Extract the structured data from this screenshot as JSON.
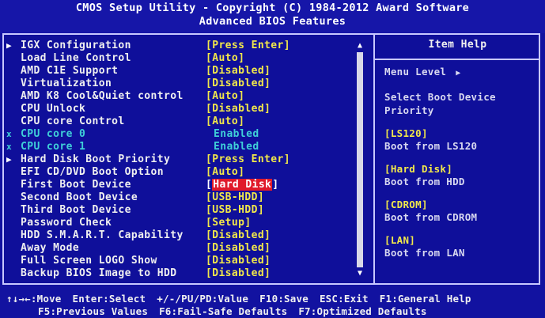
{
  "header": {
    "line1": "CMOS Setup Utility - Copyright (C) 1984-2012 Award Software",
    "line2": "Advanced BIOS Features"
  },
  "settings": [
    {
      "label": "IGX Configuration",
      "value": "[Press Enter]",
      "submenu": true,
      "arrow": "▶"
    },
    {
      "label": "Load Line Control",
      "value": "[Auto]"
    },
    {
      "label": "AMD C1E Support",
      "value": "[Disabled]"
    },
    {
      "label": "Virtualization",
      "value": "[Disabled]"
    },
    {
      "label": "AMD K8 Cool&Quiet control",
      "value": "[Auto]"
    },
    {
      "label": "CPU Unlock",
      "value": "[Disabled]"
    },
    {
      "label": "CPU core Control",
      "value": "[Auto]"
    },
    {
      "label": "CPU core 0",
      "value": "Enabled",
      "disabled": true,
      "arrow": "x"
    },
    {
      "label": "CPU core 1",
      "value": "Enabled",
      "disabled": true,
      "arrow": "x"
    },
    {
      "label": "Hard Disk Boot Priority",
      "value": "[Press Enter]",
      "submenu": true,
      "arrow": "▶"
    },
    {
      "label": "EFI CD/DVD Boot Option",
      "value": "[Auto]"
    },
    {
      "label": "First Boot Device",
      "value": "[Hard Disk]",
      "selected": true,
      "value_inner": "Hard Disk"
    },
    {
      "label": "Second Boot Device",
      "value": "[USB-HDD]"
    },
    {
      "label": "Third Boot Device",
      "value": "[USB-HDD]"
    },
    {
      "label": "Password Check",
      "value": "[Setup]"
    },
    {
      "label": "HDD S.M.A.R.T. Capability",
      "value": "[Disabled]"
    },
    {
      "label": "Away Mode",
      "value": "[Disabled]"
    },
    {
      "label": "Full Screen LOGO Show",
      "value": "[Disabled]"
    },
    {
      "label": "Backup BIOS Image to HDD",
      "value": "[Disabled]"
    }
  ],
  "help": {
    "title": "Item Help",
    "menu_level": "Menu Level",
    "menu_level_arrow": "▶",
    "desc_line1": "Select Boot Device",
    "desc_line2": "Priority",
    "options": [
      {
        "key": "[LS120]",
        "text": "Boot from LS120"
      },
      {
        "key": "[Hard Disk]",
        "text": "Boot from HDD"
      },
      {
        "key": "[CDROM]",
        "text": "Boot from CDROM"
      },
      {
        "key": "[LAN]",
        "text": "Boot from LAN"
      }
    ]
  },
  "footer": {
    "line1": [
      "↑↓→←:Move",
      "Enter:Select",
      "+/-/PU/PD:Value",
      "F10:Save",
      "ESC:Exit",
      "F1:General Help"
    ],
    "line2": [
      "F5:Previous Values",
      "F6:Fail-Safe Defaults",
      "F7:Optimized Defaults"
    ]
  },
  "scrollbar": {
    "up": "▲",
    "down": "▼"
  },
  "colors": {
    "background": "#1212a0",
    "value": "#f2e84a",
    "disabled": "#3fd0d8",
    "highlight": "#e01a2a"
  }
}
